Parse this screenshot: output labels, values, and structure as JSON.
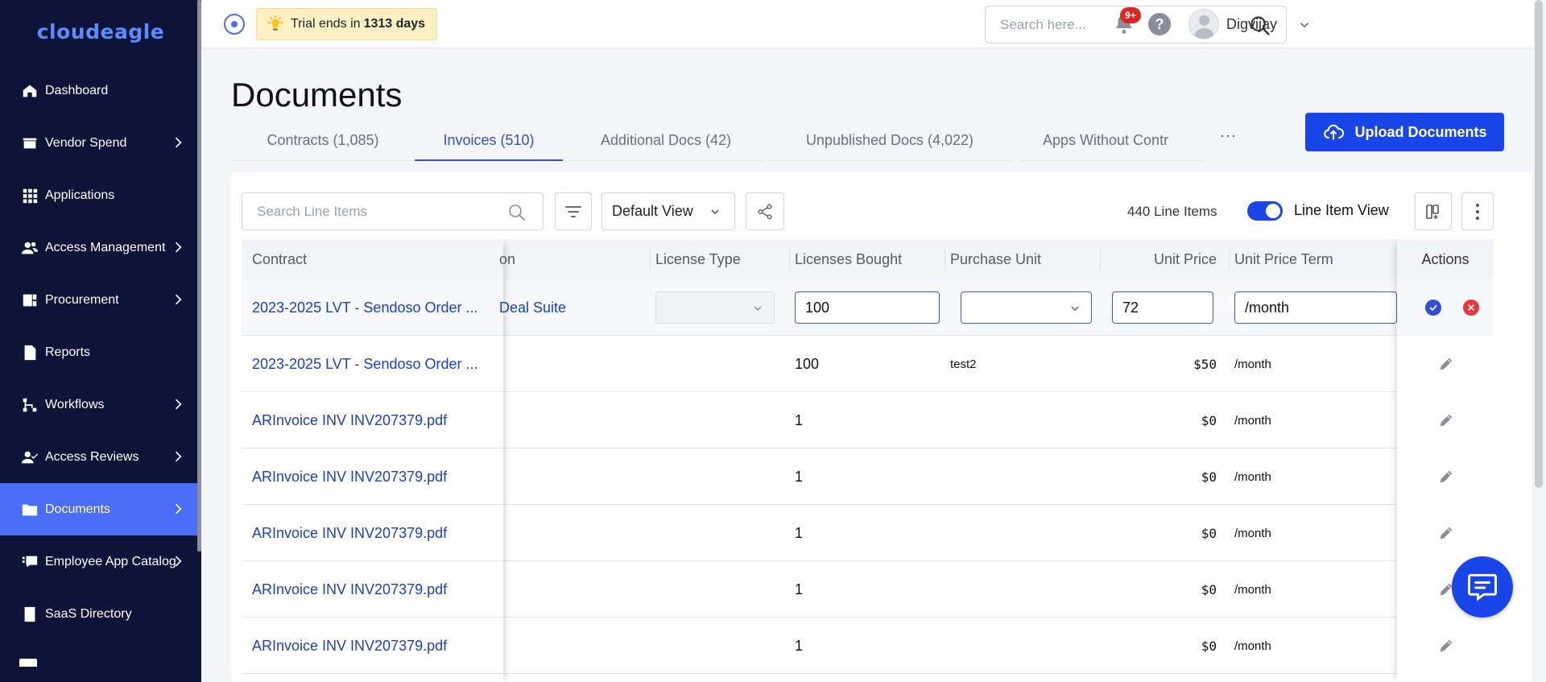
{
  "brand": {
    "logo_text": "cloudeagle",
    "accent": "#4c6ef5",
    "primary": "#1a45e8",
    "sidebar_bg": "#0d1437"
  },
  "sidebar": {
    "items": [
      {
        "label": "Dashboard",
        "icon": "home-icon",
        "chevron": false,
        "active": false
      },
      {
        "label": "Vendor Spend",
        "icon": "store-icon",
        "chevron": true,
        "active": false
      },
      {
        "label": "Applications",
        "icon": "grid-icon",
        "chevron": false,
        "active": false
      },
      {
        "label": "Access Management",
        "icon": "users-icon",
        "chevron": true,
        "active": false
      },
      {
        "label": "Procurement",
        "icon": "procurement-icon",
        "chevron": true,
        "active": false
      },
      {
        "label": "Reports",
        "icon": "report-icon",
        "chevron": false,
        "active": false
      },
      {
        "label": "Workflows",
        "icon": "workflow-icon",
        "chevron": true,
        "active": false
      },
      {
        "label": "Access Reviews",
        "icon": "user-check-icon",
        "chevron": true,
        "active": false
      },
      {
        "label": "Documents",
        "icon": "folder-icon",
        "chevron": true,
        "active": true
      },
      {
        "label": "Employee App Catalog",
        "icon": "catalog-icon",
        "chevron": true,
        "active": false
      },
      {
        "label": "SaaS Directory",
        "icon": "directory-icon",
        "chevron": false,
        "active": false
      }
    ]
  },
  "topbar": {
    "trial_prefix": "Trial ends in",
    "trial_days": "1313 days",
    "search_placeholder": "Search here...",
    "notification_badge": "9+",
    "help_label": "?",
    "username": "Digvijay"
  },
  "page": {
    "title": "Documents",
    "tabs": [
      {
        "label": "Contracts (1,085)",
        "active": false
      },
      {
        "label": "Invoices (510)",
        "active": true
      },
      {
        "label": "Additional Docs (42)",
        "active": false
      },
      {
        "label": "Unpublished Docs (4,022)",
        "active": false
      },
      {
        "label": "Apps Without Contr",
        "active": false
      }
    ],
    "tabs_more": "···",
    "upload_label": "Upload Documents"
  },
  "toolbar": {
    "search_placeholder": "Search Line Items",
    "view_label": "Default View",
    "line_item_count": "440 Line Items",
    "toggle_label": "Line Item View",
    "toggle_on": true
  },
  "table": {
    "columns": {
      "contract": "Contract",
      "application_partial": "on",
      "license_type": "License Type",
      "licenses_bought": "Licenses Bought",
      "purchase_unit": "Purchase Unit",
      "unit_price": "Unit Price",
      "unit_price_term": "Unit Price Term",
      "actions": "Actions"
    },
    "editing_row": {
      "contract": "2023-2025 LVT - Sendoso Order ...",
      "application_partial": "Deal Suite",
      "licenses_bought": "100",
      "unit_price": "72",
      "unit_price_term": "/month"
    },
    "rows": [
      {
        "contract": "2023-2025 LVT - Sendoso Order ...",
        "licenses_bought": "100",
        "purchase_unit": "test2",
        "unit_price": "$50",
        "unit_price_term": "/month"
      },
      {
        "contract": "ARInvoice INV INV207379.pdf",
        "licenses_bought": "1",
        "purchase_unit": "",
        "unit_price": "$0",
        "unit_price_term": "/month"
      },
      {
        "contract": "ARInvoice INV INV207379.pdf",
        "licenses_bought": "1",
        "purchase_unit": "",
        "unit_price": "$0",
        "unit_price_term": "/month"
      },
      {
        "contract": "ARInvoice INV INV207379.pdf",
        "licenses_bought": "1",
        "purchase_unit": "",
        "unit_price": "$0",
        "unit_price_term": "/month"
      },
      {
        "contract": "ARInvoice INV INV207379.pdf",
        "licenses_bought": "1",
        "purchase_unit": "",
        "unit_price": "$0",
        "unit_price_term": "/month"
      },
      {
        "contract": "ARInvoice INV INV207379.pdf",
        "licenses_bought": "1",
        "purchase_unit": "",
        "unit_price": "$0",
        "unit_price_term": "/month"
      }
    ]
  }
}
